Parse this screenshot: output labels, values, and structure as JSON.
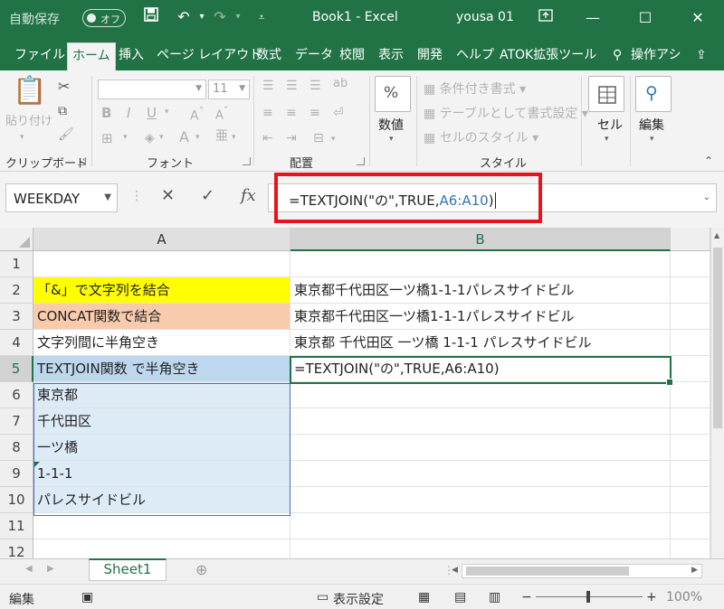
{
  "title_bar": {
    "autosave_label": "自動保存",
    "autosave_state": "オフ",
    "doc_title": "Book1  -  Excel",
    "user": "yousa 01",
    "colors": {
      "excel_green": "#217346"
    }
  },
  "ribbon_tabs": [
    {
      "label": "ファイル"
    },
    {
      "label": "ホーム"
    },
    {
      "label": "挿入"
    },
    {
      "label": "ページ レイアウト"
    },
    {
      "label": "数式"
    },
    {
      "label": "データ"
    },
    {
      "label": "校閲"
    },
    {
      "label": "表示"
    },
    {
      "label": "開発"
    },
    {
      "label": "ヘルプ"
    },
    {
      "label": "ATOK拡張ツール"
    },
    {
      "label": "操作アシ"
    }
  ],
  "ribbon": {
    "clipboard": {
      "paste": "貼り付け",
      "group": "クリップボード"
    },
    "font": {
      "name_value": "",
      "size_value": "11",
      "group": "フォント"
    },
    "alignment": {
      "group": "配置"
    },
    "number": {
      "label": "数値"
    },
    "styles": {
      "conditional": "条件付き書式",
      "table": "テーブルとして書式設定",
      "cell_styles": "セルのスタイル",
      "group": "スタイル"
    },
    "cells": {
      "label": "セル"
    },
    "editing": {
      "label": "編集"
    }
  },
  "formula_bar": {
    "name_box": "WEEKDAY",
    "formula_prefix": "=TEXTJOIN(\"の\",TRUE,",
    "formula_ref": "A6:A10",
    "formula_suffix": ")"
  },
  "grid": {
    "columns": [
      "A",
      "B"
    ],
    "rows": [
      {
        "n": "1",
        "a": "",
        "b": ""
      },
      {
        "n": "2",
        "a": "「&」で文字列を結合",
        "b": "東京都千代田区一ツ橋1-1-1パレスサイドビル"
      },
      {
        "n": "3",
        "a": "CONCAT関数で結合",
        "b": "東京都千代田区一ツ橋1-1-1パレスサイドビル"
      },
      {
        "n": "4",
        "a": "文字列間に半角空き",
        "b": "東京都 千代田区 一ツ橋 1-1-1 パレスサイドビル"
      },
      {
        "n": "5",
        "a": "TEXTJOIN関数 で半角空き",
        "b": "=TEXTJOIN(\"の\",TRUE,A6:A10)"
      },
      {
        "n": "6",
        "a": "東京都",
        "b": ""
      },
      {
        "n": "7",
        "a": "千代田区",
        "b": ""
      },
      {
        "n": "8",
        "a": "一ツ橋",
        "b": ""
      },
      {
        "n": "9",
        "a": "1-1-1",
        "b": ""
      },
      {
        "n": "10",
        "a": "パレスサイドビル",
        "b": ""
      },
      {
        "n": "11",
        "a": "",
        "b": ""
      },
      {
        "n": "12",
        "a": "",
        "b": ""
      }
    ],
    "fill_colors": {
      "row2": "#ffff00",
      "row3": "#f8cbad",
      "row5": "#bdd7ee",
      "range": "#ddebf7"
    }
  },
  "sheet_tabs": [
    {
      "label": "Sheet1"
    }
  ],
  "status_bar": {
    "mode": "編集",
    "display_settings": "表示設定",
    "zoom": "100%"
  }
}
